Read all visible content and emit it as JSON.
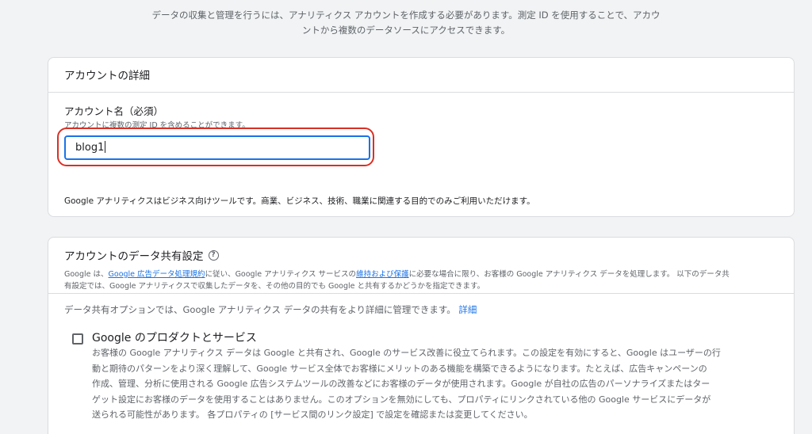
{
  "intro": {
    "line1": "データの収集と管理を行うには、アナリティクス アカウントを作成する必要があります。測定 ID を使用することで、アカウ",
    "line2": "ントから複数のデータソースにアクセスできます。"
  },
  "account_details": {
    "title": "アカウントの詳細",
    "field_label": "アカウント名（必須）",
    "field_hint": "アカウントに複数の測定 ID を含めることができます。",
    "field_value": "blog1",
    "business_note": "Google アナリティクスはビジネス向けツールです。商業、ビジネス、技術、職業に関連する目的でのみご利用いただけます。"
  },
  "data_sharing": {
    "title": "アカウントのデータ共有設定",
    "desc_part1": "Google は、",
    "desc_link1": "Google 広告データ処理規約",
    "desc_part2": "に従い、Google アナリティクス サービスの",
    "desc_link2": "維持および保護",
    "desc_part3": "に必要な場合に限り、お客様の Google アナリティクス データを処理します。 以下のデータ共",
    "desc_line2": "有設定では、Google アナリティクスで収集したデータを、その他の目的でも Google と共有するかどうかを指定できます。",
    "share_note": "データ共有オプションでは、Google アナリティクス データの共有をより詳細に管理できます。",
    "share_link": "詳細",
    "option": {
      "title": "Google のプロダクトとサービス",
      "checked": false,
      "line1": "お客様の Google アナリティクス データは Google と共有され、Google のサービス改善に役立てられます。この設定を有効にすると、Google はユーザーの行",
      "line2": "動と期待のパターンをより深く理解して、Google サービス全体でお客様にメリットのある機能を構築できるようになります。たとえば、広告キャンペーンの",
      "line3": "作成、管理、分析に使用される Google 広告システムツールの改善などにお客様のデータが使用されます。Google が自社の広告のパーソナライズまたはター",
      "line4": "ゲット設定にお客様のデータを使用することはありません。このオプションを無効にしても、プロパティにリンクされている他の Google サービスにデータが",
      "line5": "送られる可能性があります。 各プロパティの [サービス間のリンク設定] で設定を確認または変更してください。"
    }
  }
}
